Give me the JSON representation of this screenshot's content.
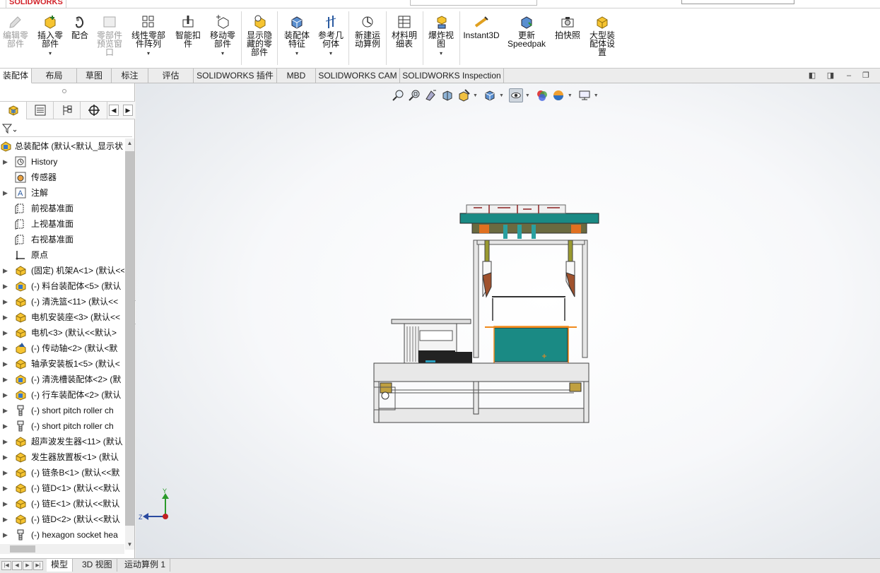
{
  "app": {
    "logo_text": "SOLIDWORKS"
  },
  "commands": [
    {
      "id": "edit-part",
      "label": "编辑零\n部件",
      "enabled": false,
      "dropdown": false
    },
    {
      "id": "insert-part",
      "label": "插入零\n部件",
      "enabled": true,
      "dropdown": true
    },
    {
      "id": "mate",
      "label": "配合",
      "enabled": true,
      "dropdown": false
    },
    {
      "id": "part-preview",
      "label": "零部件\n预览窗\n口",
      "enabled": false,
      "dropdown": false
    },
    {
      "id": "linear-pattern",
      "label": "线性零部\n件阵列",
      "enabled": true,
      "dropdown": true
    },
    {
      "id": "smart-fasteners",
      "label": "智能扣\n件",
      "enabled": true,
      "dropdown": false
    },
    {
      "id": "move-part",
      "label": "移动零\n部件",
      "enabled": true,
      "dropdown": true
    },
    {
      "id": "show-hidden",
      "label": "显示隐\n藏的零\n部件",
      "enabled": true,
      "dropdown": false
    },
    {
      "id": "assembly-feature",
      "label": "装配体\n特征",
      "enabled": true,
      "dropdown": true
    },
    {
      "id": "ref-geometry",
      "label": "参考几\n何体",
      "enabled": true,
      "dropdown": true
    },
    {
      "id": "new-motion-study",
      "label": "新建运\n动算例",
      "enabled": true,
      "dropdown": false
    },
    {
      "id": "bom",
      "label": "材料明\n细表",
      "enabled": true,
      "dropdown": false
    },
    {
      "id": "exploded-view",
      "label": "爆炸视\n图",
      "enabled": true,
      "dropdown": true
    },
    {
      "id": "instant3d",
      "label": "Instant3D",
      "enabled": true,
      "dropdown": false
    },
    {
      "id": "update-speedpak",
      "label": "更新\nSpeedpak",
      "enabled": true,
      "dropdown": false
    },
    {
      "id": "snapshot",
      "label": "拍快照",
      "enabled": true,
      "dropdown": false
    },
    {
      "id": "large-assembly",
      "label": "大型装\n配体设\n置",
      "enabled": true,
      "dropdown": false
    }
  ],
  "tabs": [
    "装配体",
    "布局",
    "草图",
    "标注",
    "评估",
    "SOLIDWORKS 插件",
    "MBD",
    "SOLIDWORKS CAM",
    "SOLIDWORKS Inspection"
  ],
  "active_tab": "装配体",
  "tree": {
    "root": "总装配体  (默认<默认_显示状",
    "items": [
      {
        "label": "History",
        "icon": "history-icon"
      },
      {
        "label": "传感器",
        "icon": "sensor-icon"
      },
      {
        "label": "注解",
        "icon": "annotation-icon"
      },
      {
        "label": "前视基准面",
        "icon": "plane-icon"
      },
      {
        "label": "上视基准面",
        "icon": "plane-icon"
      },
      {
        "label": "右视基准面",
        "icon": "plane-icon"
      },
      {
        "label": "原点",
        "icon": "origin-icon"
      },
      {
        "label": "(固定) 机架A<1> (默认<<",
        "icon": "part-icon"
      },
      {
        "label": "(-) 料台装配体<5> (默认",
        "icon": "subassembly-icon"
      },
      {
        "label": "(-) 清洗篮<11> (默认<<",
        "icon": "part-icon"
      },
      {
        "label": "电机安装座<3> (默认<<",
        "icon": "part-icon"
      },
      {
        "label": "电机<3> (默认<<默认>",
        "icon": "part-icon"
      },
      {
        "label": "(-) 传动轴<2> (默认<默",
        "icon": "part-warning-icon"
      },
      {
        "label": "轴承安装板1<5> (默认<",
        "icon": "part-icon"
      },
      {
        "label": "(-) 清洗槽装配体<2> (默",
        "icon": "subassembly-icon"
      },
      {
        "label": "(-) 行车装配体<2> (默认",
        "icon": "subassembly-icon"
      },
      {
        "label": "(-) short pitch roller ch",
        "icon": "toolbox-icon"
      },
      {
        "label": "(-) short pitch roller ch",
        "icon": "toolbox-icon"
      },
      {
        "label": "超声波发生器<11> (默认",
        "icon": "part-icon"
      },
      {
        "label": "发生器放置板<1> (默认",
        "icon": "part-icon"
      },
      {
        "label": "(-) 链条B<1> (默认<<默",
        "icon": "part-icon"
      },
      {
        "label": "(-) 链D<1> (默认<<默认",
        "icon": "part-icon"
      },
      {
        "label": "(-) 链E<1> (默认<<默认",
        "icon": "part-icon"
      },
      {
        "label": "(-) 链D<2> (默认<<默认",
        "icon": "part-icon"
      },
      {
        "label": "(-) hexagon socket hea",
        "icon": "toolbox-icon"
      }
    ]
  },
  "triad": {
    "y": "Y",
    "z": "Z"
  },
  "bottom_tabs": [
    "模型",
    "3D 视图",
    "运动算例 1"
  ],
  "active_bottom_tab": "模型",
  "colors": {
    "model_teal": "#1a8a84",
    "selection_orange": "#f08a1c",
    "frame_gray": "#e8e8e8"
  }
}
